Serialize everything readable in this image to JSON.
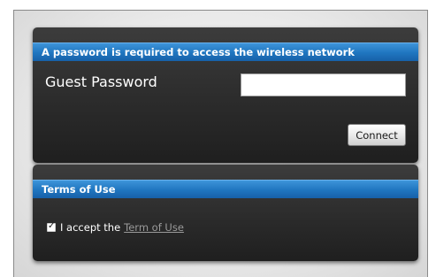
{
  "login_panel": {
    "header": "A password is required to access the wireless network",
    "guest_label": "Guest Password",
    "password_value": "",
    "password_placeholder": "",
    "connect_label": "Connect"
  },
  "terms_panel": {
    "header": "Terms of Use",
    "accept_checked": true,
    "check_glyph": "✓",
    "accept_text": "I accept the",
    "link_text": "Term of Use"
  },
  "colors": {
    "header_blue": "#1f75bf",
    "panel_dark": "#2a2a2a",
    "link_gray": "#9a9a9a"
  }
}
